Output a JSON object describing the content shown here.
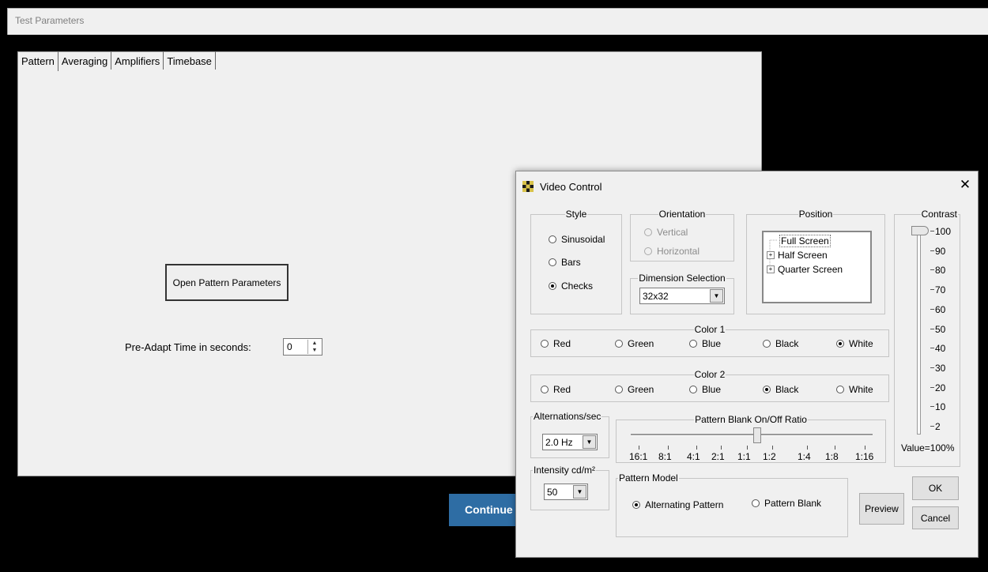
{
  "main_window": {
    "title": "Test Parameters",
    "tabs": [
      "Pattern",
      "Averaging",
      "Amplifiers",
      "Timebase"
    ],
    "open_pattern_button": "Open Pattern Parameters",
    "preadapt_label": "Pre-Adapt Time in seconds:",
    "preadapt_value": "0",
    "continue_button": "Continue"
  },
  "dialog": {
    "title": "Video Control",
    "close_glyph": "✕",
    "style": {
      "legend": "Style",
      "options": [
        "Sinusoidal",
        "Bars",
        "Checks"
      ],
      "selected": "Checks"
    },
    "orientation": {
      "legend": "Orientation",
      "options": [
        "Vertical",
        "Horizontal"
      ]
    },
    "dimension": {
      "legend": "Dimension Selection",
      "value": "32x32"
    },
    "position": {
      "legend": "Position",
      "items": [
        "Full Screen",
        "Half Screen",
        "Quarter Screen"
      ],
      "selected": "Full Screen"
    },
    "contrast": {
      "legend": "Contrast",
      "ticks": [
        "100",
        "90",
        "80",
        "70",
        "60",
        "50",
        "40",
        "30",
        "20",
        "10",
        "2"
      ],
      "value_label": "Value=100%",
      "value": 100
    },
    "color1": {
      "legend": "Color 1",
      "options": [
        "Red",
        "Green",
        "Blue",
        "Black",
        "White"
      ],
      "selected": "White"
    },
    "color2": {
      "legend": "Color 2",
      "options": [
        "Red",
        "Green",
        "Blue",
        "Black",
        "White"
      ],
      "selected": "Black"
    },
    "alternations": {
      "legend": "Alternations/sec",
      "value": "2.0 Hz"
    },
    "blank_ratio": {
      "legend": "Pattern Blank On/Off Ratio",
      "ticks": [
        "16:1",
        "8:1",
        "4:1",
        "2:1",
        "1:1",
        "1:2",
        "1:4",
        "1:8",
        "1:16"
      ],
      "selected": "1:1"
    },
    "intensity": {
      "legend": "Intensity cd/m²",
      "value": "50"
    },
    "pattern_model": {
      "legend": "Pattern Model",
      "options": [
        "Alternating Pattern",
        "Pattern Blank"
      ],
      "selected": "Alternating Pattern"
    },
    "buttons": {
      "preview": "Preview",
      "ok": "OK",
      "cancel": "Cancel"
    }
  }
}
